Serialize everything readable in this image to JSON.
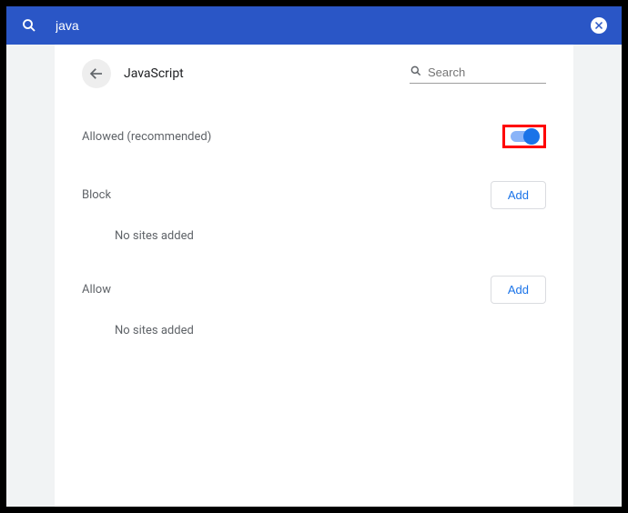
{
  "topbar": {
    "search_value": "java"
  },
  "panel": {
    "title": "JavaScript",
    "search_placeholder": "Search",
    "allowed_label": "Allowed (recommended)",
    "allowed_toggle": true,
    "block": {
      "heading": "Block",
      "add_label": "Add",
      "empty": "No sites added"
    },
    "allow": {
      "heading": "Allow",
      "add_label": "Add",
      "empty": "No sites added"
    }
  }
}
